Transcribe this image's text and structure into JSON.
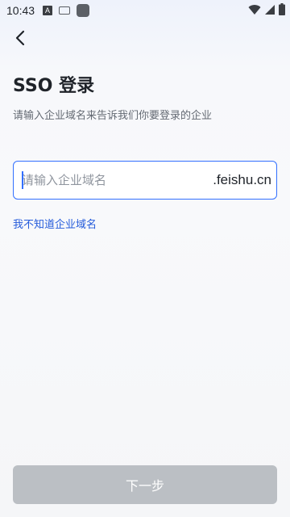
{
  "status_bar": {
    "time": "10:43",
    "icons": [
      "a-notification-icon",
      "keyboard-icon",
      "app-icon",
      "wifi-icon",
      "signal-icon",
      "battery-icon"
    ]
  },
  "nav": {
    "back_icon": "chevron-left-icon"
  },
  "page": {
    "title": "SSO 登录",
    "subtitle": "请输入企业域名来告诉我们你要登录的企业"
  },
  "domain_field": {
    "value": "",
    "placeholder": "请输入企业域名",
    "suffix": ".feishu.cn"
  },
  "help_link": "我不知道企业域名",
  "next_button": "下一步",
  "colors": {
    "accent": "#3370ff",
    "link": "#245bdb",
    "button_disabled": "#bbbfc4",
    "title_text": "#1f2329",
    "secondary_text": "#646a73"
  }
}
